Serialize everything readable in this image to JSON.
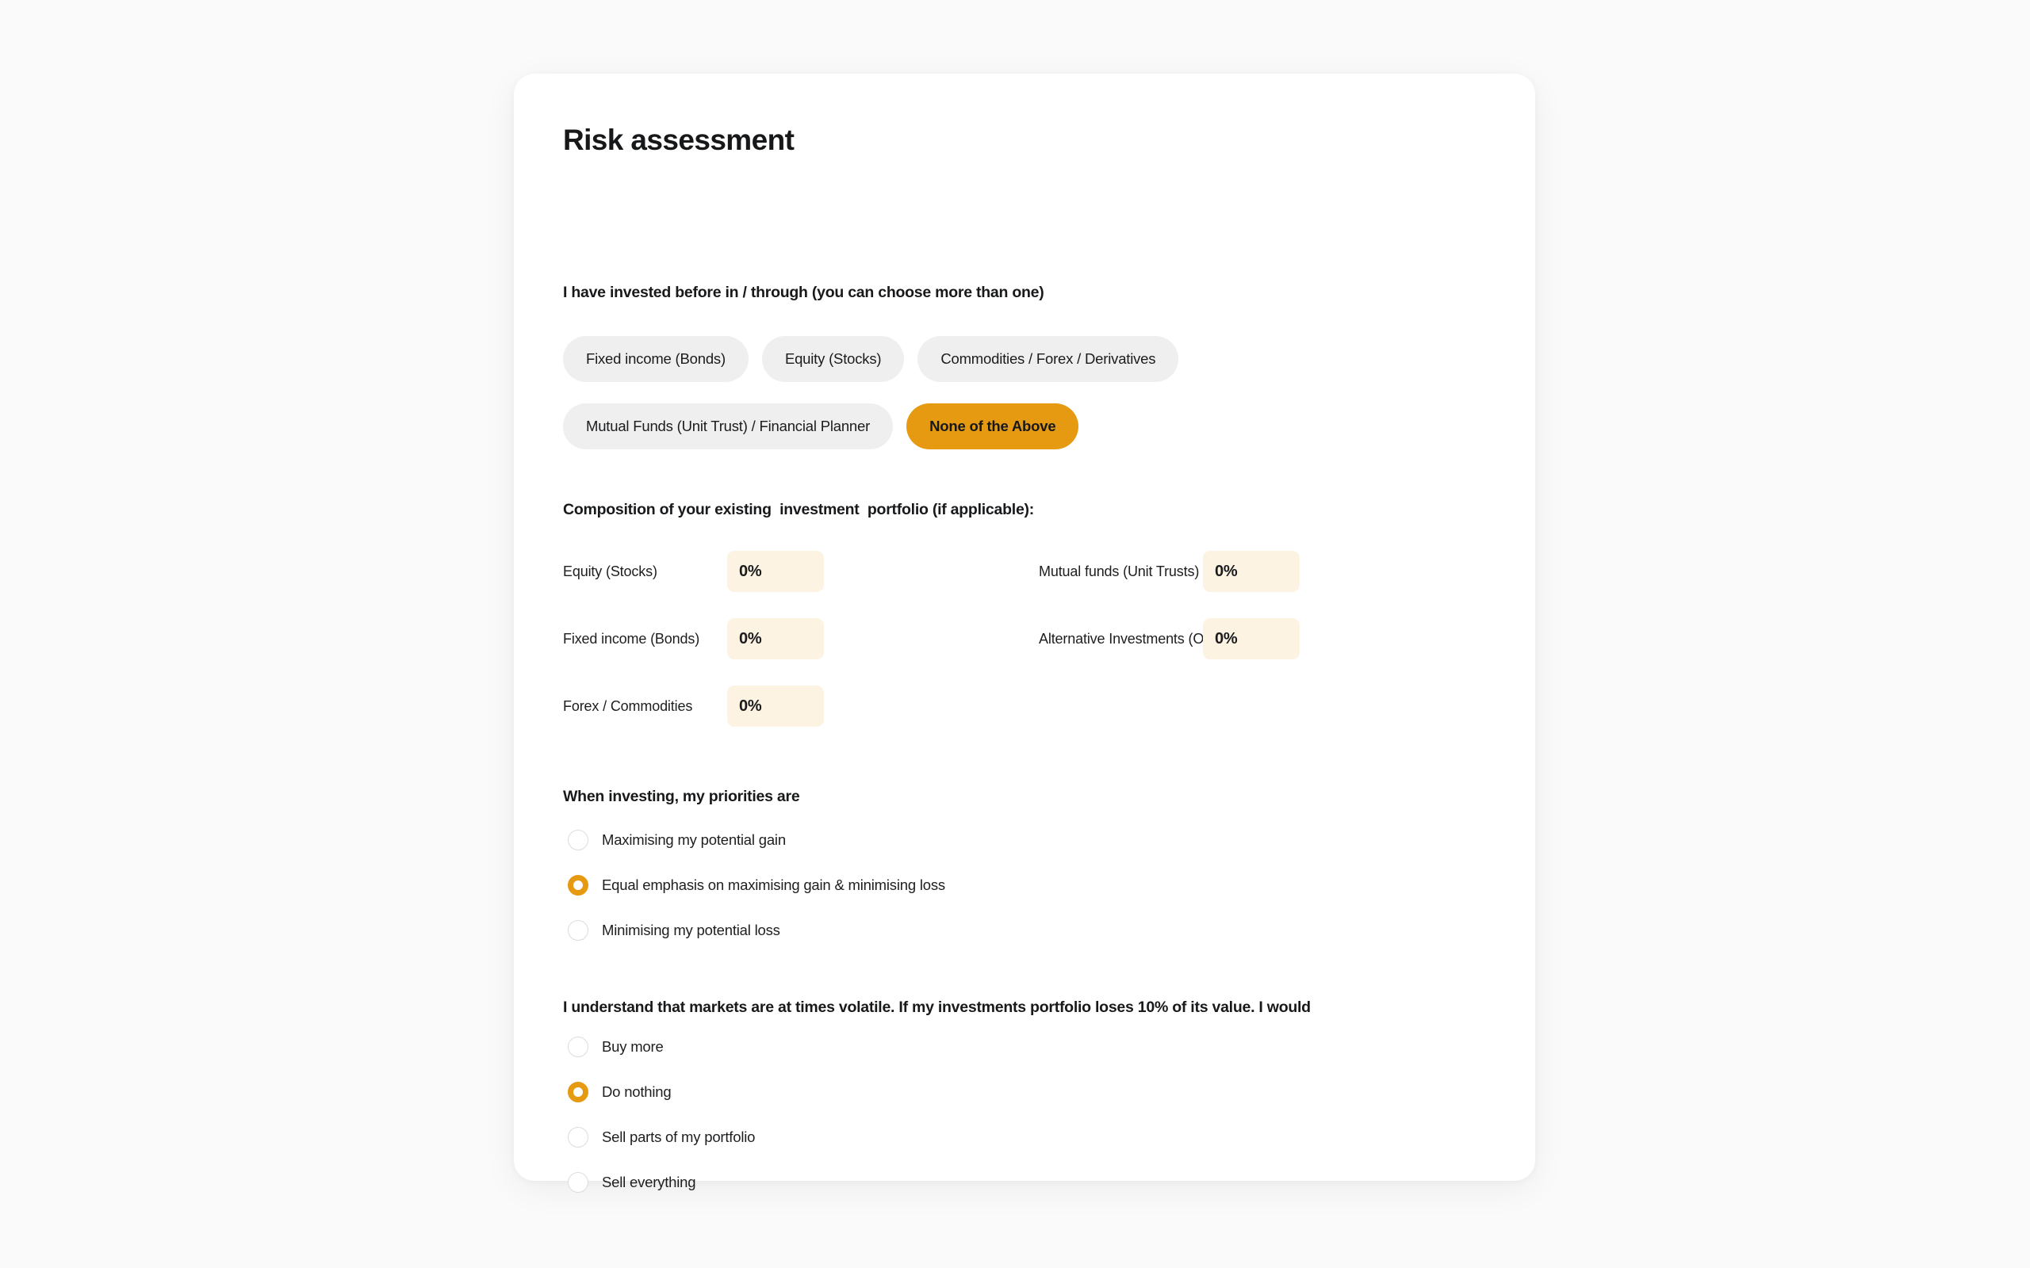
{
  "page": {
    "title": "Risk assessment",
    "accent_color": "#e59a11",
    "card_background": "#ffffff",
    "page_background": "#fafafa",
    "chip_background": "#efefef",
    "input_background": "#fdf3e3"
  },
  "q1": {
    "label": "I have invested before in / through (you can choose more than one)",
    "chips_row1": [
      {
        "label": "Fixed income (Bonds)",
        "selected": false
      },
      {
        "label": "Equity (Stocks)",
        "selected": false
      },
      {
        "label": "Commodities / Forex / Derivatives",
        "selected": false
      }
    ],
    "chips_row2": [
      {
        "label": "Mutual Funds (Unit Trust) / Financial Planner",
        "selected": false
      },
      {
        "label": "None of the Above",
        "selected": true
      }
    ]
  },
  "q2": {
    "label": "Composition of your existing  investment  portfolio (if applicable):",
    "rows": [
      {
        "left": {
          "label": "Equity (Stocks)",
          "value": "0%",
          "placeholder": "0%"
        },
        "right": {
          "label": "Mutual funds (Unit Trusts)",
          "value": "0%",
          "placeholder": "0%"
        }
      },
      {
        "left": {
          "label": "Fixed income (Bonds)",
          "value": "0%",
          "placeholder": "0%"
        },
        "right": {
          "label": "Alternative Investments (Othesr)",
          "value": "0%",
          "placeholder": "0%"
        }
      },
      {
        "left": {
          "label": "Forex / Commodities",
          "value": "0%",
          "placeholder": "0%"
        },
        "right": null
      }
    ]
  },
  "q3": {
    "label": "When investing, my priorities are",
    "options": [
      {
        "label": "Maximising my potential gain",
        "selected": false
      },
      {
        "label": "Equal emphasis on maximising gain & minimising loss",
        "selected": true
      },
      {
        "label": "Minimising my potential loss",
        "selected": false
      }
    ]
  },
  "q4": {
    "label": "I understand that markets are at times volatile. If my investments portfolio loses 10% of its value. I would",
    "options": [
      {
        "label": "Buy more",
        "selected": false
      },
      {
        "label": "Do nothing",
        "selected": true
      },
      {
        "label": "Sell parts of my portfolio",
        "selected": false
      },
      {
        "label": "Sell everything",
        "selected": false
      }
    ]
  }
}
